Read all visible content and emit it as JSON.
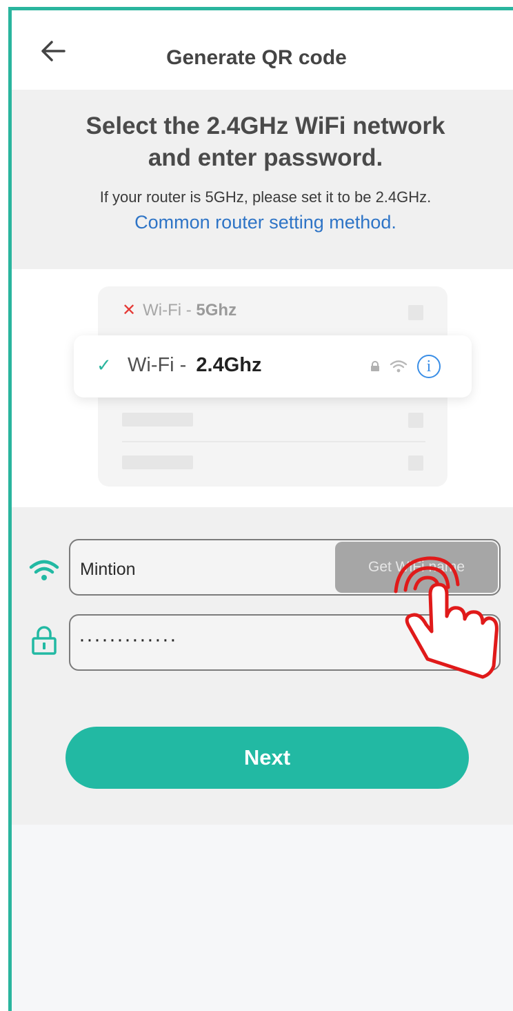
{
  "header": {
    "title": "Generate QR code"
  },
  "info": {
    "headline_line1": "Select the 2.4GHz WiFi network",
    "headline_line2": "and enter password.",
    "note": "If your router is 5GHz, please set it to be 2.4GHz.",
    "link": "Common router setting method."
  },
  "illustration": {
    "wrong_network_prefix": "Wi-Fi - ",
    "wrong_network_band": "5Ghz",
    "correct_network_prefix": "Wi-Fi - ",
    "correct_network_band": "2.4Ghz",
    "info_glyph": "i"
  },
  "form": {
    "wifi_name_value": "Mintion",
    "get_wifi_name_label": "Get WiFi name",
    "password_value": "·············",
    "next_label": "Next"
  },
  "colors": {
    "accent": "#22b9a3",
    "link": "#2e74c6",
    "error": "#e53935",
    "pointer_hand": "#e01a1a"
  },
  "icons": {
    "back": "back-arrow-icon",
    "wifi": "wifi-icon",
    "lock": "lock-icon",
    "info": "info-icon",
    "check": "check-icon",
    "cross": "cross-icon",
    "hand": "tap-hand-icon"
  }
}
